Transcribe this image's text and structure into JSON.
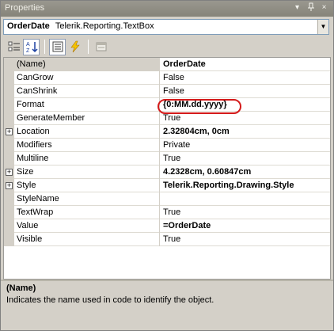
{
  "window": {
    "title": "Properties",
    "buttons": {
      "dropdown": "▾",
      "pin": "ᵖ",
      "close": "×"
    }
  },
  "object_selector": {
    "name": "OrderDate",
    "type": "Telerik.Reporting.TextBox"
  },
  "toolbar": {
    "tools": [
      {
        "name": "categorized-view-icon",
        "active": false
      },
      {
        "name": "alphabetical-sort-icon",
        "active": true
      },
      {
        "name": "properties-icon",
        "active": true
      },
      {
        "name": "events-lightning-icon",
        "active": false
      },
      {
        "name": "property-pages-icon",
        "active": false
      }
    ]
  },
  "grid": {
    "rows": [
      {
        "name": "(Name)",
        "value": "OrderDate",
        "bold": true,
        "expandable": false
      },
      {
        "name": "CanGrow",
        "value": "False",
        "bold": false,
        "expandable": false
      },
      {
        "name": "CanShrink",
        "value": "False",
        "bold": false,
        "expandable": false
      },
      {
        "name": "Format",
        "value": "{0:MM.dd.yyyy}",
        "bold": true,
        "expandable": false
      },
      {
        "name": "GenerateMember",
        "value": "True",
        "bold": false,
        "expandable": false
      },
      {
        "name": "Location",
        "value": "2.32804cm, 0cm",
        "bold": true,
        "expandable": true
      },
      {
        "name": "Modifiers",
        "value": "Private",
        "bold": false,
        "expandable": false
      },
      {
        "name": "Multiline",
        "value": "True",
        "bold": false,
        "expandable": false
      },
      {
        "name": "Size",
        "value": "4.2328cm, 0.60847cm",
        "bold": true,
        "expandable": true
      },
      {
        "name": "Style",
        "value": "Telerik.Reporting.Drawing.Style",
        "bold": true,
        "expandable": true
      },
      {
        "name": "StyleName",
        "value": "",
        "bold": false,
        "expandable": false
      },
      {
        "name": "TextWrap",
        "value": "True",
        "bold": false,
        "expandable": false
      },
      {
        "name": "Value",
        "value": "=OrderDate",
        "bold": true,
        "expandable": false
      },
      {
        "name": "Visible",
        "value": "True",
        "bold": false,
        "expandable": false
      }
    ],
    "expand_glyph": "+"
  },
  "description": {
    "title": "(Name)",
    "text": "Indicates the name used in code to identify the object."
  },
  "colors": {
    "highlight": "#d41a1a",
    "titlebar": "#8f8d84"
  }
}
